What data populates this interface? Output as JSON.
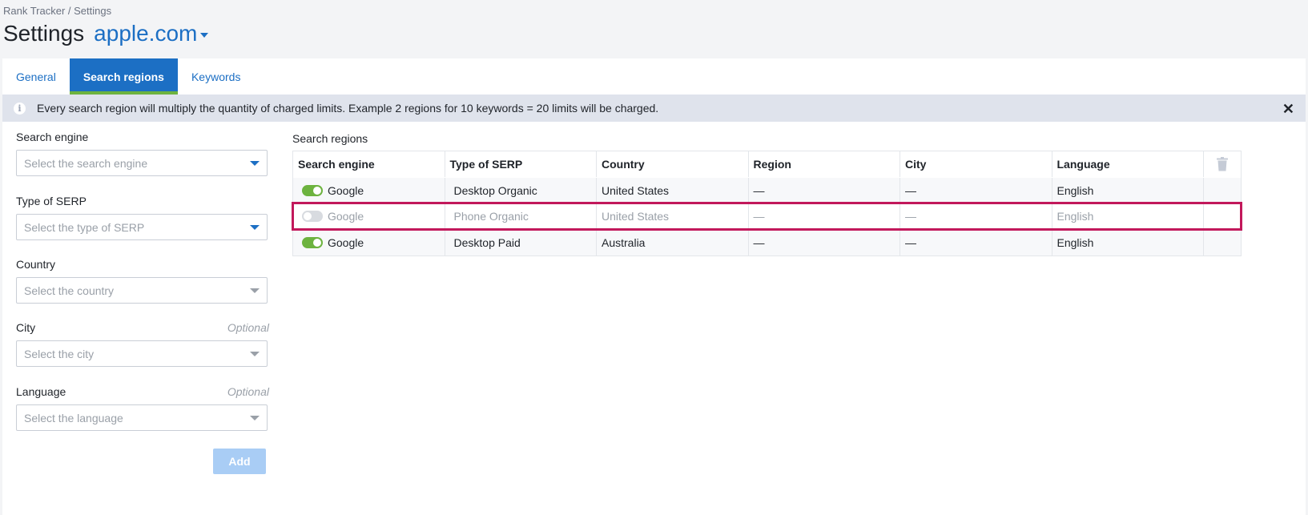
{
  "breadcrumb": "Rank Tracker / Settings",
  "title": "Settings",
  "project": "apple.com",
  "tabs": [
    {
      "label": "General",
      "active": false
    },
    {
      "label": "Search regions",
      "active": true
    },
    {
      "label": "Keywords",
      "active": false
    }
  ],
  "notice": "Every search region will multiply the quantity of charged limits. Example 2 regions for 10 keywords = 20 limits will be charged.",
  "form": {
    "engine_label": "Search engine",
    "engine_placeholder": "Select the search engine",
    "serp_label": "Type of SERP",
    "serp_placeholder": "Select the type of SERP",
    "country_label": "Country",
    "country_placeholder": "Select the country",
    "city_label": "City",
    "city_optional": "Optional",
    "city_placeholder": "Select the city",
    "language_label": "Language",
    "language_optional": "Optional",
    "language_placeholder": "Select the language",
    "add_label": "Add"
  },
  "regions": {
    "title": "Search regions",
    "columns": [
      "Search engine",
      "Type of SERP",
      "Country",
      "Region",
      "City",
      "Language"
    ],
    "rows": [
      {
        "enabled": true,
        "engine": "Google",
        "serp": "Desktop Organic",
        "country": "United States",
        "region": "—",
        "city": "—",
        "language": "English"
      },
      {
        "enabled": false,
        "engine": "Google",
        "serp": "Phone Organic",
        "country": "United States",
        "region": "—",
        "city": "—",
        "language": "English"
      },
      {
        "enabled": true,
        "engine": "Google",
        "serp": "Desktop Paid",
        "country": "Australia",
        "region": "—",
        "city": "—",
        "language": "English"
      }
    ]
  },
  "colors": {
    "accent": "#1c6fc4",
    "toggle_on": "#6db33f",
    "highlight": "#c2185b",
    "notice_bg": "#dfe3ec"
  }
}
